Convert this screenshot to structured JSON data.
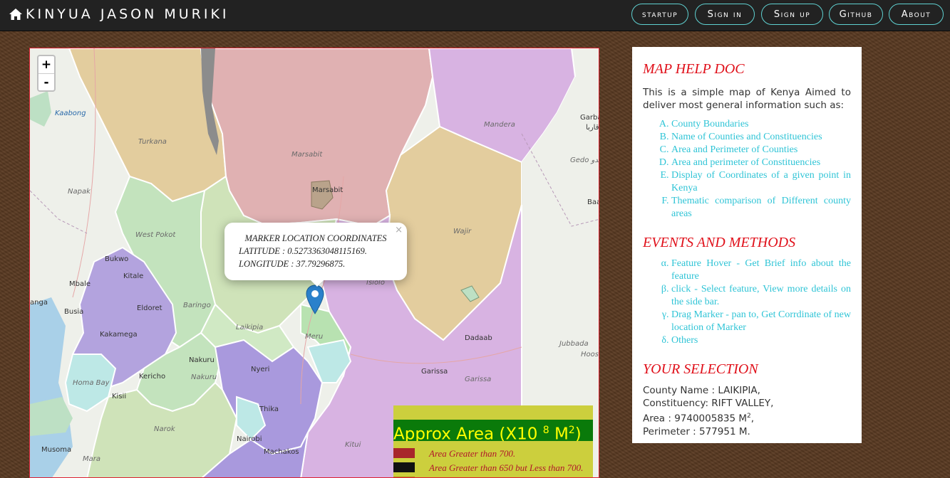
{
  "navbar": {
    "brand": "KINYUA JASON MURIKI",
    "links": [
      "startup",
      "Sign in",
      "Sign up",
      "Github",
      "About"
    ]
  },
  "map": {
    "zoom_in": "+",
    "zoom_out": "-",
    "places": {
      "kaabong": "Kaabong",
      "turkana": "Turkana",
      "marsabit_county": "Marsabit",
      "marsabit_town": "Marsabit",
      "mandera": "Mandera",
      "garba": "Garba",
      "garba_ar": "قاربا",
      "gedo": "Gedo جدو",
      "baa": "Baa",
      "napak": "Napak",
      "wajir": "Wajir",
      "west_pokot": "West Pokot",
      "bukwo": "Bukwo",
      "kitale": "Kitale",
      "mbale": "Mbale",
      "baringo": "Baringo",
      "isiolo": "Isiolo",
      "anga": "anga",
      "busia": "Busia",
      "eldoret": "Eldoret",
      "laikipia": "Laikipia",
      "kakamega": "Kakamega",
      "meru": "Meru",
      "dadaab": "Dadaab",
      "jubbada": "Jubbada",
      "hoos": "Hoos",
      "nakuru_town": "Nakuru",
      "nyeri": "Nyeri",
      "homa_bay": "Homa Bay",
      "kericho": "Kericho",
      "nakuru_county": "Nakuru",
      "garissa_town": "Garissa",
      "garissa_county": "Garissa",
      "kisii": "Kisii",
      "thika": "Thika",
      "narok": "Narok",
      "nairobi": "Nairobi",
      "kitui": "Kitui",
      "machakos": "Machakos",
      "musoma": "Musoma",
      "mara": "Mara"
    },
    "popup": {
      "title": "MARKER LOCATION COORDINATES",
      "latitude": "LATITUDE : 0.5273363048115169.",
      "longitude": "LONGITUDE : 37.79296875.",
      "close": "×"
    },
    "marker": {
      "latitude": 0.5273363048115169,
      "longitude": 37.79296875
    }
  },
  "legend": {
    "title_prefix": "Approx Area (X10 ",
    "title_exp": "8",
    "title_unit": " M",
    "title_unit_exp": "2",
    "title_suffix": ")",
    "rows": [
      {
        "label": "Area Greater than 700.",
        "color": "#a8262b"
      },
      {
        "label": "Area Greater than 650 but Less than 700.",
        "color": "#111111"
      },
      {
        "label": "",
        "color": "#b08a1a"
      }
    ]
  },
  "panel": {
    "help_title": "MAP HELP DOC",
    "intro": "This is a simple map of Kenya Aimed to deliver most general information such as:",
    "help_items": [
      "County Boundaries",
      "Name of Counties and Constituencies",
      "Area and Perimeter of Counties",
      "Area and perimeter of Constituencies",
      "Display of Coordinates of a given point in Kenya",
      "Thematic comparison of Different county areas"
    ],
    "events_title": "EVENTS AND METHODS",
    "events_items": [
      "Feature Hover - Get Brief info about the feature",
      "click - Select feature, View more details on the side bar.",
      "Drag Marker - pan to, Get Corrdinate of new location of Marker",
      "Others"
    ],
    "selection_title": "YOUR SELECTION",
    "selection": {
      "county": "County Name : LAIKIPIA,",
      "constituency": "Constituency: RIFT VALLEY,",
      "area_prefix": "Area : 9740005835 M",
      "area_exp": "2",
      "area_suffix": ",",
      "perimeter": "Perimeter : 577951 M."
    }
  },
  "colors": {
    "navbar_bg": "#222222",
    "nav_border": "#5fd1d1",
    "heading_red": "#e0101a",
    "list_cyan": "#2fc4d6",
    "legend_bg": "#cccf3d",
    "legend_title_bg": "#0a7a0a",
    "legend_title_text": "#ffff00",
    "marker_blue": "#2a81cb"
  }
}
